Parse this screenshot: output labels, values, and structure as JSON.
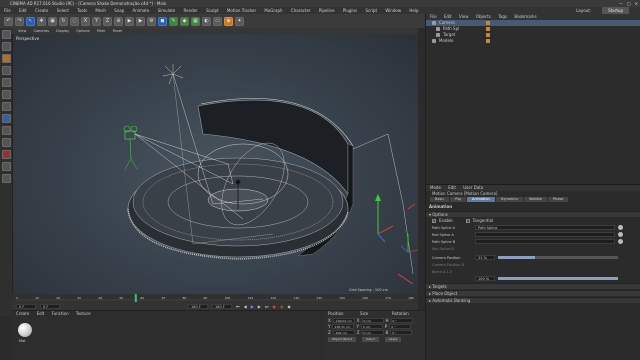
{
  "title_bar": {
    "text": "CINEMA 4D R17.016 Studio (RC) - [Camera Shake Demonstração.c4d *] - Main"
  },
  "menu_bar": {
    "items": [
      "File",
      "Edit",
      "Create",
      "Select",
      "Tools",
      "Mesh",
      "Snap",
      "Animate",
      "Simulate",
      "Render",
      "Sculpt",
      "Motion Tracker",
      "MoGraph",
      "Character",
      "Pipeline",
      "Plugins",
      "Script",
      "Window",
      "Help"
    ],
    "layout_label": "Layout:",
    "layout_value": "Startup"
  },
  "viewport": {
    "menu_items": [
      "View",
      "Cameras",
      "Display",
      "Options",
      "Filter",
      "Panel"
    ],
    "label": "Perspective",
    "grid_spacing": "Grid Spacing : 100 cm"
  },
  "timeline": {
    "ticks": [
      "0",
      "10",
      "20",
      "30",
      "40",
      "50",
      "60",
      "70",
      "80",
      "90",
      "100",
      "110",
      "120",
      "130",
      "140",
      "150",
      "160",
      "170",
      "180"
    ],
    "current_frame": "0 F",
    "start_field": "0 F",
    "end_field": "180 F",
    "end_field2": "180 F",
    "progress": 0.3
  },
  "material_manager": {
    "menu_items": [
      "Create",
      "Edit",
      "Function",
      "Texture"
    ],
    "materials": [
      "Mat"
    ]
  },
  "coordinates": {
    "headers": [
      "Position",
      "Size",
      "Rotation"
    ],
    "rows": [
      {
        "pos_axis": "X",
        "pos": "-199.02 cm",
        "size_axis": "X",
        "size": "0 cm",
        "rot_axis": "H",
        "rot": "0 °"
      },
      {
        "pos_axis": "Y",
        "pos": "238.31 cm",
        "size_axis": "Y",
        "size": "0 cm",
        "rot_axis": "P",
        "rot": "0 °"
      },
      {
        "pos_axis": "Z",
        "pos": "-602 cm",
        "size_axis": "Z",
        "size": "0 cm",
        "rot_axis": "B",
        "rot": "0 °"
      }
    ],
    "object_mode": "Object (Rel) ▾",
    "size_mode": "Size ▾",
    "apply": "Apply"
  },
  "object_manager": {
    "menu_items": [
      "File",
      "Edit",
      "View",
      "Objects",
      "Tags",
      "Bookmarks"
    ],
    "objects": [
      {
        "name": "Camera",
        "selected": true
      },
      {
        "name": "Path Spl",
        "selected": false
      },
      {
        "name": "Target",
        "selected": false
      },
      {
        "name": "Modelo",
        "selected": false
      }
    ]
  },
  "attributes_manager": {
    "menu_items": [
      "Mode",
      "Edit",
      "User Data"
    ],
    "title": "Motion Camera [Motion Camera]",
    "tabs": [
      "Basic",
      "Rig",
      "Animation",
      "Dynamics",
      "Wobble",
      "Phase"
    ],
    "active_tab": "Animation",
    "section_header": "Animation",
    "sub_header": "Options",
    "enable_label": "Enable",
    "tangential_label": "Tangential",
    "fields": [
      {
        "label": "Path Spline A",
        "value": "Path Spline"
      },
      {
        "label": "Rail Spline A",
        "value": ""
      },
      {
        "label": "Path Spline B",
        "value": ""
      },
      {
        "label": "Rail Spline B",
        "value": ""
      }
    ],
    "camera_position_label": "Camera Position",
    "camera_position_value": "31 %",
    "camera_position_fraction": 0.31,
    "dim_rows": [
      "Camera Position B",
      "Blend A 1.0"
    ],
    "bottom_value": "100 %",
    "collapsed_sections": [
      "Targets",
      "Place Object",
      "Automatic Banking"
    ]
  }
}
